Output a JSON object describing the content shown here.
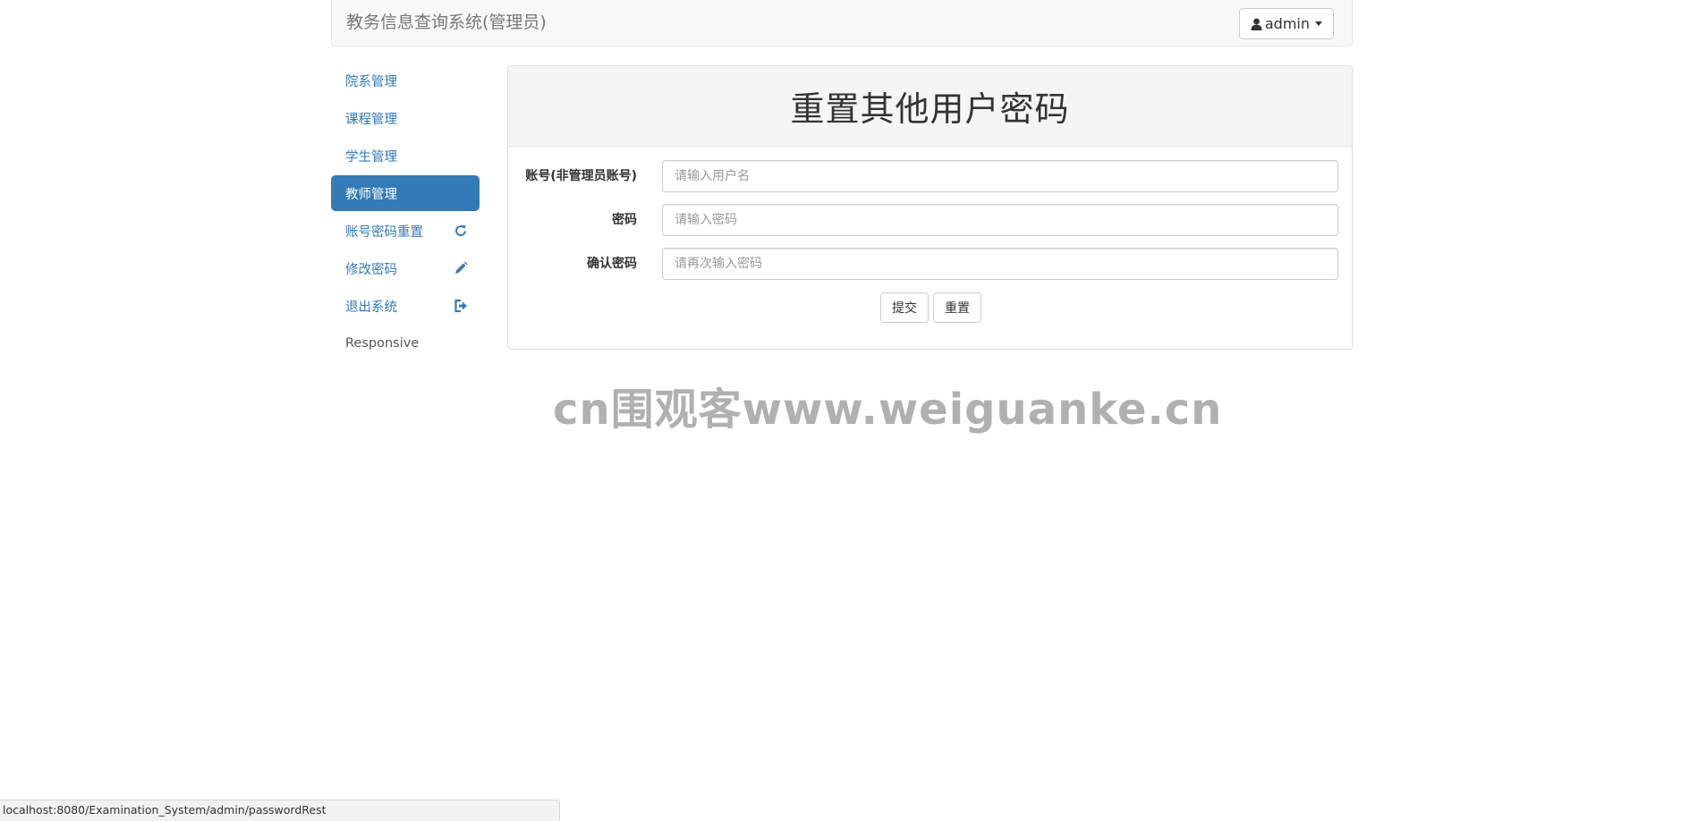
{
  "navbar": {
    "brand": "教务信息查询系统(管理员)",
    "user_label": "admin"
  },
  "sidebar": {
    "items": [
      {
        "label": "院系管理",
        "icon": null,
        "active": false
      },
      {
        "label": "课程管理",
        "icon": null,
        "active": false
      },
      {
        "label": "学生管理",
        "icon": null,
        "active": false
      },
      {
        "label": "教师管理",
        "icon": null,
        "active": true
      },
      {
        "label": "账号密码重置",
        "icon": "refresh-icon",
        "active": false
      },
      {
        "label": "修改密码",
        "icon": "pencil-icon",
        "active": false
      },
      {
        "label": "退出系统",
        "icon": "log-out-icon",
        "active": false
      },
      {
        "label": "Responsive",
        "icon": null,
        "active": false
      }
    ]
  },
  "panel": {
    "title": "重置其他用户密码",
    "fields": [
      {
        "label": "账号(非管理员账号)",
        "placeholder": "请输入用户名",
        "value": ""
      },
      {
        "label": "密码",
        "placeholder": "请输入密码",
        "value": ""
      },
      {
        "label": "确认密码",
        "placeholder": "请再次输入密码",
        "value": ""
      }
    ],
    "submit_label": "提交",
    "reset_label": "重置"
  },
  "watermark": "cn围观客www.weiguanke.cn",
  "statusbar": {
    "url": "localhost:8080/Examination_System/admin/passwordRest"
  },
  "colors": {
    "primary": "#337ab7",
    "navbar_bg": "#f8f8f8",
    "panel_heading_bg": "#f5f5f5"
  }
}
